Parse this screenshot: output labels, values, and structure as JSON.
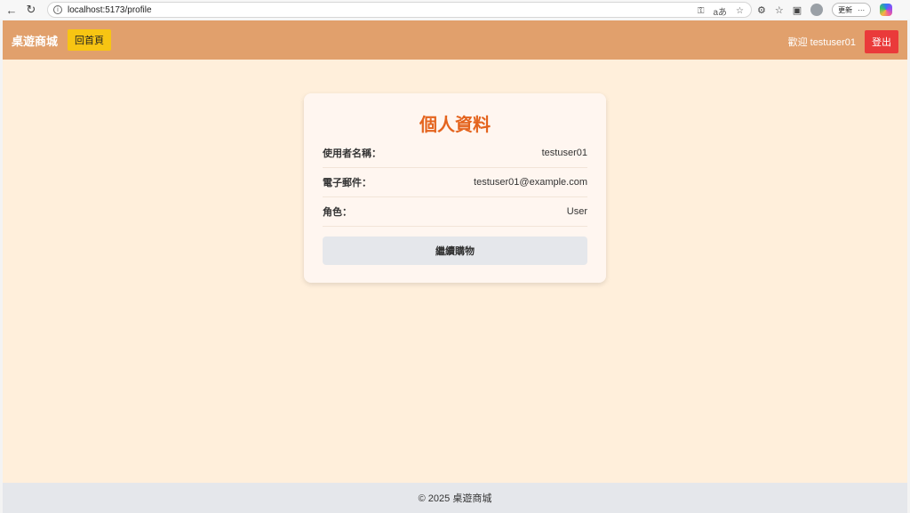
{
  "browser": {
    "url": "localhost:5173/profile",
    "update_label": "更新"
  },
  "header": {
    "brand": "桌遊商城",
    "home_label": "回首頁",
    "welcome": "歡迎 testuser01",
    "logout_label": "登出"
  },
  "profile": {
    "title": "個人資料",
    "fields": [
      {
        "label": "使用者名稱：",
        "value": "testuser01"
      },
      {
        "label": "電子郵件：",
        "value": "testuser01@example.com"
      },
      {
        "label": "角色：",
        "value": "User"
      }
    ],
    "continue_label": "繼續購物"
  },
  "footer": {
    "text": "© 2025 桌遊商城"
  },
  "colors": {
    "header_bg": "#e1a06c",
    "page_bg": "#ffefdb",
    "title": "#e4641e",
    "home_button": "#f7c513",
    "logout_button": "#ea3a3a"
  }
}
